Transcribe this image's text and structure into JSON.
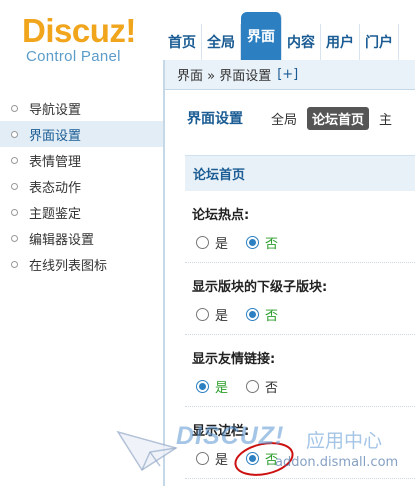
{
  "logo": {
    "main": "Discuz",
    "bang": "!",
    "sub": "Control Panel"
  },
  "topnav": [
    {
      "label": "首页",
      "active": false
    },
    {
      "label": "全局",
      "active": false
    },
    {
      "label": "界面",
      "active": true
    },
    {
      "label": "内容",
      "active": false
    },
    {
      "label": "用户",
      "active": false
    },
    {
      "label": "门户",
      "active": false
    }
  ],
  "breadcrumb": {
    "text": "界面 » 界面设置",
    "plus": "[+]"
  },
  "sidebar": [
    {
      "label": "导航设置",
      "active": false
    },
    {
      "label": "界面设置",
      "active": true
    },
    {
      "label": "表情管理",
      "active": false
    },
    {
      "label": "表态动作",
      "active": false
    },
    {
      "label": "主题鉴定",
      "active": false
    },
    {
      "label": "编辑器设置",
      "active": false
    },
    {
      "label": "在线列表图标",
      "active": false
    }
  ],
  "subbar": {
    "title": "界面设置",
    "tabs": [
      {
        "label": "全局",
        "active": false
      },
      {
        "label": "论坛首页",
        "active": true
      },
      {
        "label": "主",
        "active": false
      }
    ]
  },
  "section": {
    "title": "论坛首页"
  },
  "settings": [
    {
      "label": "论坛热点:",
      "opt1": "是",
      "opt2": "否",
      "selected": 2
    },
    {
      "label": "显示版块的下级子版块:",
      "opt1": "是",
      "opt2": "否",
      "selected": 2
    },
    {
      "label": "显示友情链接:",
      "opt1": "是",
      "opt2": "否",
      "selected": 1
    },
    {
      "label": "显示边栏:",
      "opt1": "是",
      "opt2": "否",
      "selected": 2
    }
  ],
  "watermark": {
    "brand": "DISCUZ!",
    "cn": "应用中心",
    "url": "addon.dismall.com"
  },
  "colors": {
    "accent": "#2c7fc1",
    "logo": "#f0a51c",
    "selected_text": "#2a9d2a",
    "annotation": "#cc1111"
  }
}
